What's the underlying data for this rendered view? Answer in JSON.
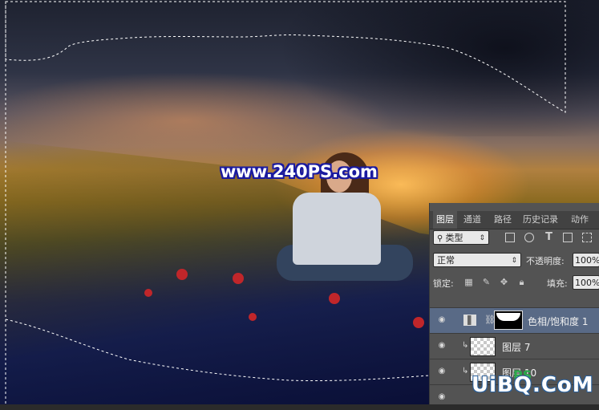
{
  "canvas": {
    "watermark_text": "www.240PS.com"
  },
  "layers_panel": {
    "tabs": [
      {
        "label": "图层",
        "active": true
      },
      {
        "label": "通道",
        "active": false
      },
      {
        "label": "路径",
        "active": false
      },
      {
        "label": "历史记录",
        "active": false
      },
      {
        "label": "动作",
        "active": false
      }
    ],
    "filter": {
      "value": "类型"
    },
    "filter_icons": [
      "image-filter-icon",
      "adjustment-filter-icon",
      "type-filter-icon",
      "shape-filter-icon",
      "smart-object-filter-icon"
    ],
    "blend_mode": {
      "value": "正常"
    },
    "opacity": {
      "label": "不透明度:",
      "value": "100%"
    },
    "lock": {
      "label": "锁定:"
    },
    "fill": {
      "label": "填充:",
      "value": "100%"
    },
    "layers": [
      {
        "name": "色相/饱和度 1",
        "selected": true,
        "type": "adjustment"
      },
      {
        "name": "图层 7",
        "selected": false,
        "type": "pixel",
        "clipped": true
      },
      {
        "name": "图层 10",
        "selected": false,
        "type": "pixel",
        "clipped": true
      }
    ]
  },
  "site_watermark": {
    "logo": "UiBQ.CoM",
    "ps_mark": "PS"
  },
  "colors": {
    "panel_bg": "#535353",
    "tab_bar_bg": "#424242",
    "selected_layer_bg": "#596a86",
    "watermark_outline": "#1a1aa0"
  }
}
